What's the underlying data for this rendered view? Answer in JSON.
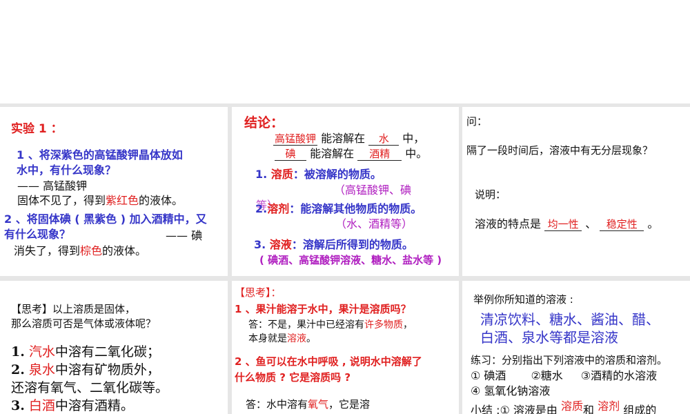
{
  "p1": {
    "title": "实验 1 ：",
    "q1_line1": "1 、将深紫色的高锰酸钾晶体放如",
    "q1_line2": "水中，有什么现象？",
    "a1_line1": "—— 高锰酸钾",
    "a1_pre": "固体不见了，得到",
    "a1_hl": "紫红色",
    "a1_post": "的液体。",
    "q2_line1": "2 、将固体碘 ( 黑紫色 ) 加入酒精中，又",
    "q2_line2": "有什么现象？",
    "a2_dash": "—— 碘",
    "a2_pre": "消失了，得到",
    "a2_hl": "棕色",
    "a2_post": "的液体。"
  },
  "p2": {
    "title": "结论：",
    "b1": "高锰酸钾",
    "l1_mid": "能溶解在",
    "b2": "水",
    "l1_end": "中，",
    "b3": "碘",
    "l2_mid": "能溶解在",
    "b4": "酒精",
    "l2_end": "中。",
    "d1_num": "1.",
    "d1_term": "溶质",
    "d1_def": "：被溶解的物质。",
    "d1_ex": "（高锰酸钾、碘",
    "d1_ex2": "等）",
    "d2_num": "2.",
    "d2_term": "溶剂",
    "d2_def": "：能溶解其他物质的物质。",
    "d2_ex": "（水、酒精等）",
    "d3_num": "3.",
    "d3_term": "溶液",
    "d3_def": "：溶解后所得到的物质。",
    "d3_ex": "( 碘酒、高锰酸钾溶液、糖水、盐水等 )"
  },
  "p3": {
    "ask": "问：",
    "question": "隔了一段时间后，溶液中有无分层现象？",
    "explain": "说明：",
    "feat_pre": "溶液的特点是",
    "blank1": "均一性",
    "sep": "、",
    "blank2": "稳定性",
    "end": "。"
  },
  "p4": {
    "think1": "【思考】以上溶质是固体，",
    "think2": "那么溶质可否是气体或液体呢？",
    "i1_num": "1.",
    "i1_hl": "汽水",
    "i1_rest": "中溶有二氧化碳；",
    "i2_num": "2.",
    "i2_hl": "泉水",
    "i2_rest": "中溶有矿物质外，",
    "i2_line2": "还溶有氧气、二氧化碳等。",
    "i3_num": "3.",
    "i3_hl": "白酒",
    "i3_rest": "中溶有酒精。"
  },
  "p5": {
    "title": "【思考】：",
    "q1": "1 、果汁能溶于水中，果汁是溶质吗？",
    "a1_pre": "答：不是，果汁中已经溶有",
    "a1_hl": "许多物质",
    "a1_post": "，",
    "a1_l2_pre": "本身就是",
    "a1_l2_hl": "溶液",
    "a1_l2_post": "。",
    "q2_l1": "2 、鱼可以在水中呼吸 , 说明水中溶解了",
    "q2_l2": "什么物质 ? 它是溶质吗 ?",
    "a2_pre": "答：水中溶有",
    "a2_hl": "氧气",
    "a2_post": "，它是溶"
  },
  "p6": {
    "title": "举例你所知道的溶液 :",
    "ex_l1": "清凉饮料、糖水、酱油、醋、",
    "ex_l2": "白酒、泉水等都是溶液",
    "practice": "练习：分别指出下列溶液中的溶质和溶剂。",
    "items_l1a": "① 碘酒",
    "items_l1b": "②糖水",
    "items_l1c": "③酒精的水溶液",
    "items_l2": "④ 氢氧化钠溶液",
    "sum_pre": "小结 :① 溶液是由",
    "sum_b1": "溶质",
    "sum_and": "和",
    "sum_b2": "溶剂",
    "sum_post": "组成的"
  }
}
